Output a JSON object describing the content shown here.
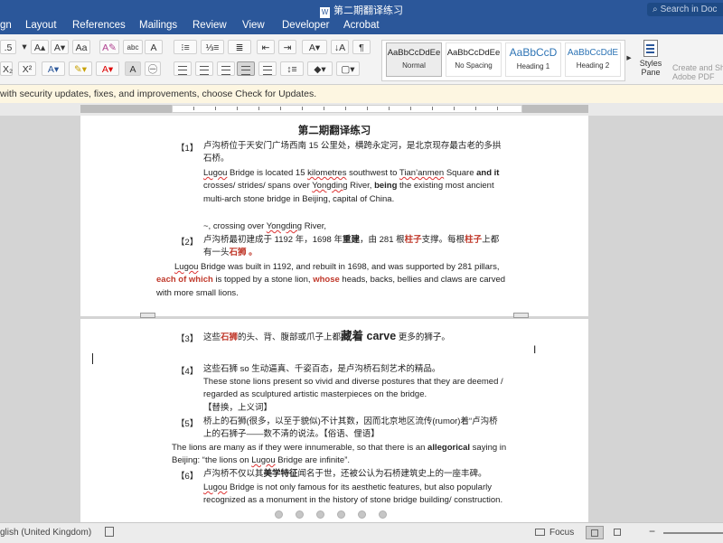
{
  "window": {
    "doc_title": "第二期翻译练习",
    "search_placeholder": "Search in Doc"
  },
  "tabs": [
    "gn",
    "Layout",
    "References",
    "Mailings",
    "Review",
    "View",
    "Developer",
    "Acrobat"
  ],
  "ribbon": {
    "font_size": ".5",
    "styles": [
      {
        "preview": "AaBbCcDdEe",
        "name": "Normal"
      },
      {
        "preview": "AaBbCcDdEe",
        "name": "No Spacing"
      },
      {
        "preview": "AaBbCcD",
        "name": "Heading 1"
      },
      {
        "preview": "AaBbCcDdE",
        "name": "Heading 2"
      }
    ],
    "styles_pane": "Styles Pane",
    "create_pdf_1": "Create and Sh",
    "create_pdf_2": "Adobe PDF"
  },
  "message_bar": "with security updates, fixes, and improvements, choose Check for Updates.",
  "document": {
    "title": "第二期翻译练习",
    "p1_num": "【1】",
    "p1_zh_1": "卢沟桥位于天安门广场西南 15 公里处，横跨永定河，是北京现存最古老的多拱",
    "p1_zh_2": "石桥。",
    "p1_en_1a": "Lugou",
    "p1_en_1b": " Bridge is located 15 ",
    "p1_en_1c": "kilometres",
    "p1_en_1d": " southwest to ",
    "p1_en_1e": "Tian’anmen",
    "p1_en_1f": " Square ",
    "p1_en_1g": "and it",
    "p1_en_2a": "crosses/ strides/ spans over ",
    "p1_en_2b": "Yongding",
    "p1_en_2c": " River, ",
    "p1_en_2d": "being",
    "p1_en_2e": " the existing most ancient",
    "p1_en_3": "multi-arch stone bridge in Beijing, capital of China.",
    "p1_note_a": "~, crossing over ",
    "p1_note_b": "Yongding",
    "p1_note_c": " River,",
    "p2_num": "【2】",
    "p2_zh_1a": "卢沟桥最初建成于 1192 年，1698 年",
    "p2_zh_1b": "重建",
    "p2_zh_1c": "，由 281 根",
    "p2_zh_1d": "柱子",
    "p2_zh_1e": "支撑。每根",
    "p2_zh_1f": "柱子",
    "p2_zh_1g": "上都",
    "p2_zh_2a": "有一头",
    "p2_zh_2b": "石狮",
    "p2_zh_2c": " 。",
    "p2_en_1a": "Lugou",
    "p2_en_1b": " Bridge was built in 1192, and rebuilt in 1698, and was supported by 281 pillars,",
    "p2_en_2a": "each of which",
    "p2_en_2b": " is topped by a stone lion, ",
    "p2_en_2c": "whose",
    "p2_en_2d": " heads, backs, bellies and claws are carved",
    "p2_en_3": "with more small lions.",
    "p3_num": "【3】",
    "p3_a": "这些",
    "p3_b": "石狮",
    "p3_c": "的头、背、腹部或爪子上都",
    "p3_d": "藏着 carve",
    "p3_e": " 更多的狮子。",
    "p4_num": "【4】",
    "p4_zh": "这些石狮 so 生动逼真、千姿百态，是卢沟桥石刻艺术的精品。",
    "p4_en_1": "These stone lions present so vivid and diverse postures that they are deemed /",
    "p4_en_2": "regarded as sculptured artistic masterpieces on the bridge.",
    "p4_note": "【替换，上义词】",
    "p5_num": "【5】",
    "p5_zh_1": "桥上的石狮(很多，以至于貌似)不计其数，因而北京地区流传(rumor)着“卢沟桥",
    "p5_zh_2": "上的石狮子——数不清的说法。【俗语、俚语】",
    "p5_en_1a": "The lions are many as if they were innumerable, so that there is an ",
    "p5_en_1b": "allegorical",
    "p5_en_1c": " saying in",
    "p5_en_2a": "Beijing: “the lions on ",
    "p5_en_2b": "Lugou",
    "p5_en_2c": " Bridge are infinite”.",
    "p6_num": "【6】",
    "p6_zh_a": "卢沟桥不仅以其",
    "p6_zh_b": "美学特征",
    "p6_zh_c": "闻名于世，还被公认为石桥建筑史上的一座丰碑。",
    "p6_en_1a": "Lugou",
    "p6_en_1b": " Bridge is not only famous for its aesthetic features, but also popularly",
    "p6_en_2": "recognized as a monument in the history of stone bridge building/ construction."
  },
  "status": {
    "language": "glish (United Kingdom)",
    "focus": "Focus"
  },
  "colors": {
    "ribbon_blue": "#2b579a",
    "highlight_red": "#c0392b"
  }
}
